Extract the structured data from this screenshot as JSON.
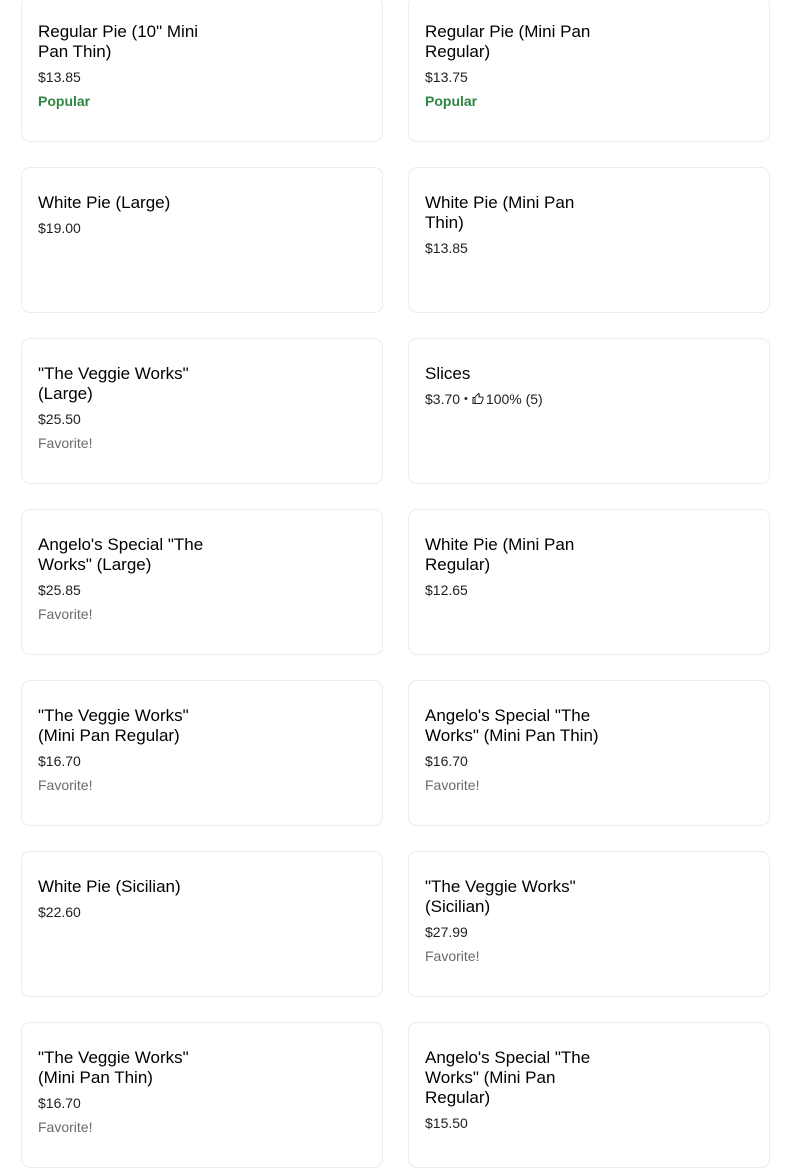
{
  "menu": {
    "items": [
      {
        "name": "Regular Pie (10\" Mini Pan Thin)",
        "price": "$13.85",
        "tag": "Popular",
        "tag_type": "popular"
      },
      {
        "name": "Regular Pie (Mini Pan Regular)",
        "price": "$13.75",
        "tag": "Popular",
        "tag_type": "popular"
      },
      {
        "name": "White Pie (Large)",
        "price": "$19.00",
        "tag": "",
        "tag_type": ""
      },
      {
        "name": "White Pie (Mini Pan Thin)",
        "price": "$13.85",
        "tag": "",
        "tag_type": ""
      },
      {
        "name": "\"The Veggie Works\" (Large)",
        "price": "$25.50",
        "tag": "Favorite!",
        "tag_type": "favorite"
      },
      {
        "name": "Slices",
        "price": "$3.70",
        "rating": "100% (5)",
        "tag": "",
        "tag_type": ""
      },
      {
        "name": "Angelo's Special \"The Works\" (Large)",
        "price": "$25.85",
        "tag": "Favorite!",
        "tag_type": "favorite"
      },
      {
        "name": "White Pie (Mini Pan Regular)",
        "price": "$12.65",
        "tag": "",
        "tag_type": ""
      },
      {
        "name": "\"The Veggie Works\" (Mini Pan Regular)",
        "price": "$16.70",
        "tag": "Favorite!",
        "tag_type": "favorite"
      },
      {
        "name": "Angelo's Special \"The Works\" (Mini Pan Thin)",
        "price": "$16.70",
        "tag": "Favorite!",
        "tag_type": "favorite"
      },
      {
        "name": "White Pie (Sicilian)",
        "price": "$22.60",
        "tag": "",
        "tag_type": ""
      },
      {
        "name": "\"The Veggie Works\" (Sicilian)",
        "price": "$27.99",
        "tag": "Favorite!",
        "tag_type": "favorite"
      },
      {
        "name": "\"The Veggie Works\" (Mini Pan Thin)",
        "price": "$16.70",
        "tag": "Favorite!",
        "tag_type": "favorite"
      },
      {
        "name": "Angelo's Special \"The Works\" (Mini Pan Regular)",
        "price": "$15.50",
        "tag": "",
        "tag_type": ""
      }
    ]
  },
  "icons": {
    "rating": "thumbs-up-icon"
  },
  "colors": {
    "popular": "#2e8540",
    "favorite": "#6b6b6b",
    "border": "#ececec"
  }
}
